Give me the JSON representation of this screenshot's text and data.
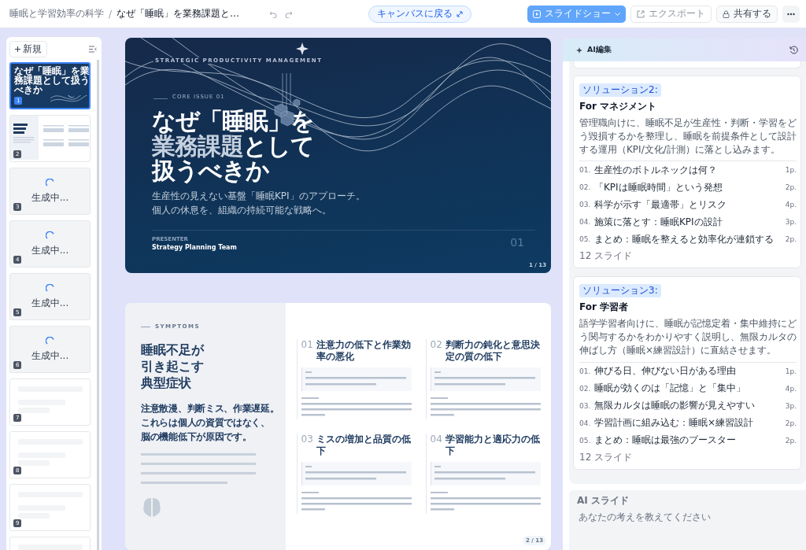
{
  "topbar": {
    "breadcrumb": [
      {
        "text": "睡眠と学習効率の科学"
      },
      {
        "text": "なぜ「睡眠」を業務課題と…"
      }
    ],
    "separator": "/",
    "canvas_button": "キャンバスに戻る",
    "slideshow_button": "スライドショー",
    "export_button": {
      "label": "エクスポート",
      "disabled": true
    },
    "share_button": "共有する"
  },
  "slide_rail": {
    "new_button": "新規",
    "thumbnails": [
      {
        "kind": "cover",
        "number": "1",
        "selected": true,
        "title": "なぜ「睡眠」を業務課題として扱うべきか"
      },
      {
        "kind": "content",
        "number": "2",
        "selected": false
      },
      {
        "kind": "generating",
        "number": "3",
        "selected": false,
        "status": "生成中..."
      },
      {
        "kind": "generating",
        "number": "4",
        "selected": false,
        "status": "生成中..."
      },
      {
        "kind": "generating",
        "number": "5",
        "selected": false,
        "status": "生成中..."
      },
      {
        "kind": "generating",
        "number": "6",
        "selected": false,
        "status": "生成中..."
      },
      {
        "kind": "pending",
        "number": "7",
        "selected": false
      },
      {
        "kind": "pending",
        "number": "8",
        "selected": false
      },
      {
        "kind": "pending",
        "number": "9",
        "selected": false
      },
      {
        "kind": "pending",
        "selected": false
      }
    ]
  },
  "cover_slide": {
    "eyebrow": "STRATEGIC PRODUCTIVITY MANAGEMENT",
    "issue": "CORE ISSUE 01",
    "title_lines": [
      {
        "segments": [
          {
            "text": "なぜ「睡眠」を",
            "highlight": false
          }
        ]
      },
      {
        "segments": [
          {
            "text": "業務課題",
            "highlight": true
          },
          {
            "text": "として",
            "highlight": false
          }
        ]
      },
      {
        "segments": [
          {
            "text": "扱うべきか",
            "highlight": false
          }
        ]
      }
    ],
    "subtitle_lines": [
      "生産性の見えない基盤「睡眠KPI」のアプローチ。",
      "個人の休息を、組織の持続可能な戦略へ。"
    ],
    "presenter_label": "PRESENTER",
    "presenter": "Strategy Planning Team",
    "big_number": "01",
    "page": "1 / 13"
  },
  "symptom_slide": {
    "eyebrow": "SYMPTOMS",
    "heading_lines": [
      "睡眠不足が",
      "引き起こす",
      "典型症状"
    ],
    "lead_lines": [
      "注意散漫、判断ミス、作業遅延。",
      "これらは個人の資質ではなく、",
      "脳の機能低下が原因です。"
    ],
    "page": "2 / 13",
    "cards": [
      {
        "number": "01",
        "title": "注意力の低下と作業効率の悪化"
      },
      {
        "number": "02",
        "title": "判断力の鈍化と意思決定の質の低下"
      },
      {
        "number": "03",
        "title": "ミスの増加と品質の低下"
      },
      {
        "number": "04",
        "title": "学習能力と適応力の低下"
      }
    ]
  },
  "ai_panel": {
    "title": "AI編集",
    "solutions": [
      {
        "tag": "ソリューション2:",
        "title": "For マネジメント",
        "description": "管理職向けに、睡眠不足が生産性・判断・学習をどう毀損するかを整理し、睡眠を前提条件として設計する運用（KPI/文化/計測）に落とし込みます。",
        "items": [
          {
            "number": "01.",
            "text": "生産性のボトルネックは何？",
            "pages": "1p."
          },
          {
            "number": "02.",
            "text": "「KPIは睡眠時間」という発想",
            "pages": "2p."
          },
          {
            "number": "03.",
            "text": "科学が示す「最適帯」とリスク",
            "pages": "4p."
          },
          {
            "number": "04.",
            "text": "施策に落とす：睡眠KPIの設計",
            "pages": "3p."
          },
          {
            "number": "05.",
            "text": "まとめ：睡眠を整えると効率化が連鎖する",
            "pages": "2p."
          }
        ],
        "count": "12 スライド"
      },
      {
        "tag": "ソリューション3:",
        "title": "For 学習者",
        "description": "語学学習者向けに、睡眠が記憶定着・集中維持にどう関与するかをわかりやすく説明し、無限カルタの伸ばし方（睡眠×練習設計）に直結させます。",
        "items": [
          {
            "number": "01.",
            "text": "伸びる日、伸びない日がある理由",
            "pages": "1p."
          },
          {
            "number": "02.",
            "text": "睡眠が効くのは「記憶」と「集中」",
            "pages": "4p."
          },
          {
            "number": "03.",
            "text": "無限カルタは睡眠の影響が見えやすい",
            "pages": "3p."
          },
          {
            "number": "04.",
            "text": "学習計画に組み込む：睡眠×練習設計",
            "pages": "2p."
          },
          {
            "number": "05.",
            "text": "まとめ：睡眠は最強のブースター",
            "pages": "2p."
          }
        ],
        "count": "12 スライド"
      }
    ],
    "ai_slide_label": "AI スライド",
    "prompt_placeholder": "あなたの考えを教えてください"
  }
}
